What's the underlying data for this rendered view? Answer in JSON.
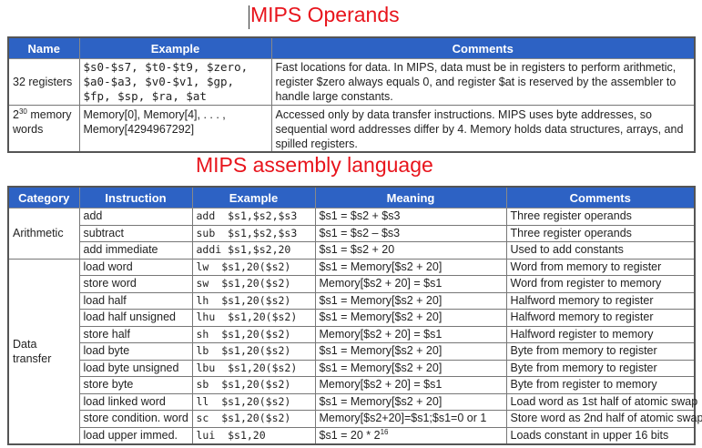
{
  "titles": {
    "operands": "MIPS Operands",
    "assembly": "MIPS assembly language"
  },
  "header_color": "#2d62c4",
  "title_color": "#e8141c",
  "operands": {
    "headers": [
      "Name",
      "Example",
      "Comments"
    ],
    "rows": [
      {
        "name": "32 registers",
        "example": "$s0-$s7, $t0-$t9, $zero, $a0-$a3, $v0-$v1, $gp, $fp, $sp, $ra, $at",
        "comments": "Fast locations for data. In MIPS, data must be in registers to perform arithmetic, register $zero always equals 0, and register $at is reserved by the assembler to handle large constants."
      },
      {
        "name_base": "2",
        "name_exp": "30",
        "name_rest": " memory words",
        "example": "Memory[0], Memory[4], . . . , Memory[4294967292]",
        "comments": "Accessed only by data transfer instructions. MIPS uses byte addresses, so sequential word addresses differ by 4. Memory holds data structures, arrays, and spilled registers."
      }
    ]
  },
  "assembly": {
    "headers": [
      "Category",
      "Instruction",
      "Example",
      "Meaning",
      "Comments"
    ],
    "categories": [
      "Arithmetic",
      "Data transfer"
    ],
    "rows": [
      {
        "instruction": "add",
        "example": "add  $s1,$s2,$s3",
        "meaning": "$s1 = $s2 + $s3",
        "comments": "Three register operands"
      },
      {
        "instruction": "subtract",
        "example": "sub  $s1,$s2,$s3",
        "meaning": "$s1 = $s2 – $s3",
        "comments": "Three register operands"
      },
      {
        "instruction": "add immediate",
        "example": "addi $s1,$s2,20",
        "meaning": "$s1 = $s2 + 20",
        "comments": "Used to add constants"
      },
      {
        "instruction": "load word",
        "example": "lw  $s1,20($s2)",
        "meaning": "$s1 = Memory[$s2 + 20]",
        "comments": "Word from memory to register"
      },
      {
        "instruction": "store word",
        "example": "sw  $s1,20($s2)",
        "meaning": "Memory[$s2 + 20] = $s1",
        "comments": "Word from register to memory"
      },
      {
        "instruction": "load half",
        "example": "lh  $s1,20($s2)",
        "meaning": "$s1 = Memory[$s2 + 20]",
        "comments": "Halfword memory to register"
      },
      {
        "instruction": "load half unsigned",
        "example": "lhu  $s1,20($s2)",
        "meaning": "$s1 = Memory[$s2 + 20]",
        "comments": "Halfword memory to register"
      },
      {
        "instruction": "store half",
        "example": "sh  $s1,20($s2)",
        "meaning": "Memory[$s2 + 20] = $s1",
        "comments": "Halfword register to memory"
      },
      {
        "instruction": "load byte",
        "example": "lb  $s1,20($s2)",
        "meaning": "$s1 = Memory[$s2 + 20]",
        "comments": "Byte from memory to register"
      },
      {
        "instruction": "load byte unsigned",
        "example": "lbu  $s1,20($s2)",
        "meaning": "$s1 = Memory[$s2 + 20]",
        "comments": "Byte from memory to register"
      },
      {
        "instruction": "store byte",
        "example": "sb  $s1,20($s2)",
        "meaning": "Memory[$s2 + 20] = $s1",
        "comments": "Byte from register to memory"
      },
      {
        "instruction": "load linked word",
        "example": "ll  $s1,20($s2)",
        "meaning": "$s1 = Memory[$s2 + 20]",
        "comments": "Load word as 1st half of atomic swap"
      },
      {
        "instruction": "store condition. word",
        "example": "sc  $s1,20($s2)",
        "meaning": "Memory[$s2+20]=$s1;$s1=0 or 1",
        "comments": "Store word as 2nd half of atomic swap"
      },
      {
        "instruction": "load upper immed.",
        "example": "lui  $s1,20",
        "meaning_base": "$s1 = 20 * 2",
        "meaning_exp": "16",
        "comments": "Loads constant in upper 16 bits"
      }
    ]
  }
}
